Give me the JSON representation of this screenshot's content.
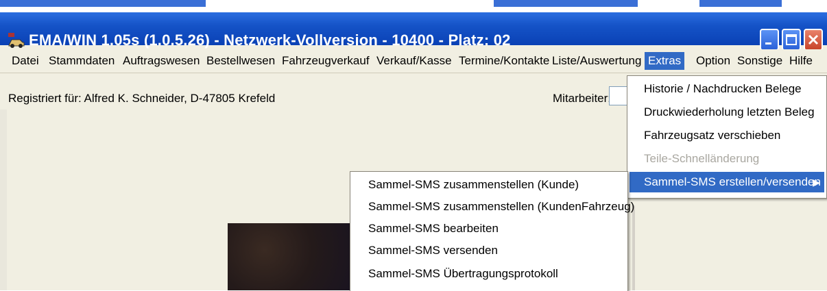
{
  "window": {
    "title": "EMA/WIN  1.05s (1.0.5.26) - Netzwerk-Vollversion - 10400 - Platz: 02",
    "icon": "ema-car-icon",
    "controls": {
      "minimize": "minimize-icon",
      "maximize": "maximize-icon",
      "close": "close-icon"
    }
  },
  "menubar": {
    "items": [
      "Datei",
      "Stammdaten",
      "Auftragswesen",
      "Bestellwesen",
      "Fahrzeugverkauf",
      "Verkauf/Kasse",
      "Termine/Kontakte",
      "Liste/Auswertung",
      "Extras",
      "Option",
      "Sonstige",
      "Hilfe"
    ],
    "active": "Extras"
  },
  "registration": {
    "text": "Registriert für: Alfred K. Schneider, D-47805 Krefeld",
    "employee_label": "Mitarbeiter:",
    "employee_value": ""
  },
  "extras_menu": {
    "items": [
      {
        "label": "Historie / Nachdrucken Belege",
        "state": "normal"
      },
      {
        "label": "Druckwiederholung letzten Beleg",
        "state": "normal"
      },
      {
        "label": "Fahrzeugsatz verschieben",
        "state": "normal"
      },
      {
        "label": "Teile-Schnelländerung",
        "state": "disabled"
      },
      {
        "label": "Sammel-SMS erstellen/versenden",
        "state": "selected",
        "submenu_arrow": "triangle-right-icon"
      }
    ]
  },
  "sms_submenu": {
    "items": [
      "Sammel-SMS zusammenstellen (Kunde)",
      "Sammel-SMS zusammenstellen (KundenFahrzeug)",
      "Sammel-SMS bearbeiten",
      "Sammel-SMS versenden",
      "Sammel-SMS Übertragungsprotokoll"
    ]
  },
  "colors": {
    "titlebar": "#0a41b5",
    "menu_highlight": "#316ac5",
    "background": "#f1efe2"
  }
}
